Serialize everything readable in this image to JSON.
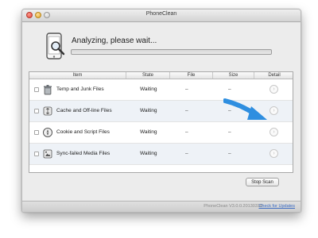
{
  "window": {
    "title": "PhoneClean"
  },
  "status": {
    "message": "Analyzing, please wait...",
    "progress_percent": 0
  },
  "table": {
    "columns": [
      "Item",
      "State",
      "File",
      "Size",
      "Detail"
    ],
    "rows": [
      {
        "label": "Temp and Junk Files",
        "state": "Waiting",
        "file": "–",
        "size": "–",
        "icon": "trash-icon"
      },
      {
        "label": "Cache and Off-line Files",
        "state": "Waiting",
        "file": "–",
        "size": "–",
        "icon": "cache-icon"
      },
      {
        "label": "Cookie and Script Files",
        "state": "Waiting",
        "file": "–",
        "size": "–",
        "icon": "compass-icon"
      },
      {
        "label": "Sync-failed Media Files",
        "state": "Waiting",
        "file": "–",
        "size": "–",
        "icon": "media-icon"
      }
    ]
  },
  "buttons": {
    "stop_scan": "Stop Scan"
  },
  "footer": {
    "version": "PhoneClean V3.0.0.20130318",
    "check_updates": "Check for Updates"
  },
  "colors": {
    "accent_arrow": "#2e8ee0",
    "link": "#3a6bc4",
    "progress_fill": "#3d86d8"
  }
}
